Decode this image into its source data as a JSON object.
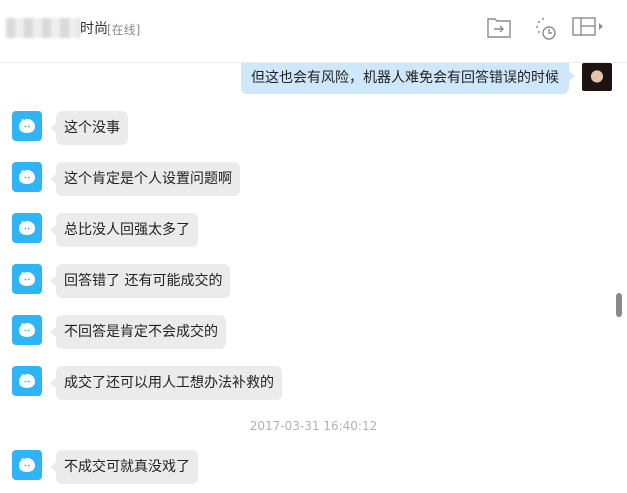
{
  "header": {
    "contact_name": "时尚",
    "status": "[在线]",
    "icons": [
      "transfer-file-icon",
      "history-icon",
      "layout-panel-icon"
    ]
  },
  "messages": [
    {
      "from": "self",
      "text": "但这也会有风险，机器人难免会有回答错误的时候"
    },
    {
      "from": "bot",
      "text": "这个没事"
    },
    {
      "from": "bot",
      "text": "这个肯定是个人设置问题啊"
    },
    {
      "from": "bot",
      "text": "总比没人回强太多了"
    },
    {
      "from": "bot",
      "text": "回答错了 还有可能成交的"
    },
    {
      "from": "bot",
      "text": "不回答是肯定不会成交的"
    },
    {
      "from": "bot",
      "text": "成交了还可以用人工想办法补救的"
    },
    {
      "from": "bot",
      "text": "不成交可就真没戏了"
    }
  ],
  "timestamp": "2017-03-31 16:40:12",
  "colors": {
    "self_bubble": "#cfe7fb",
    "bot_bubble": "#ebebeb",
    "bot_avatar": "#2fb4f5"
  }
}
